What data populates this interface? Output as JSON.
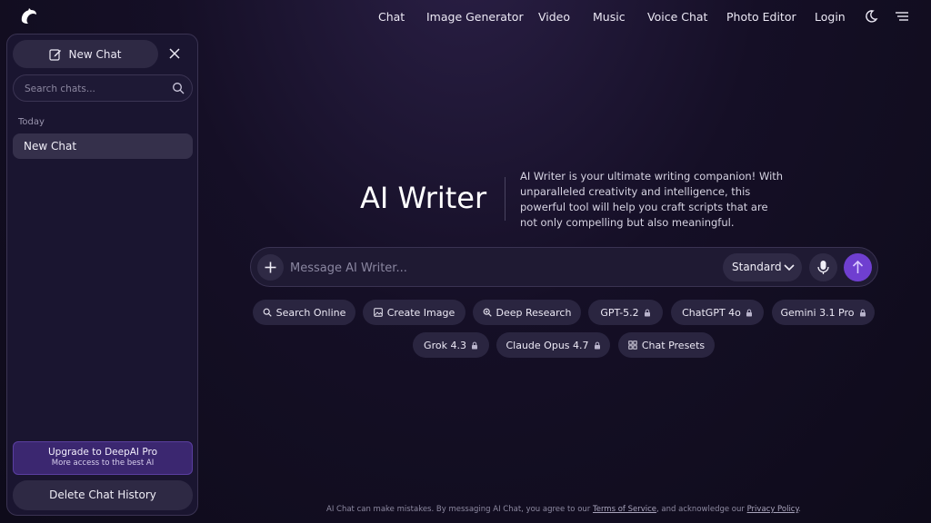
{
  "nav": {
    "links": [
      "Chat",
      "Image Generator",
      "Video",
      "Music",
      "Voice Chat",
      "Photo Editor",
      "Login"
    ],
    "logo_icon": "dolphin-logo-icon",
    "theme_icon": "moon-icon",
    "menu_icon": "hamburger-menu-icon"
  },
  "sidebar": {
    "new_chat_label": "New Chat",
    "search_placeholder": "Search chats...",
    "section_today": "Today",
    "chats": [
      "New Chat"
    ],
    "upgrade_title": "Upgrade to DeepAI Pro",
    "upgrade_subtitle": "More access to the best AI",
    "delete_label": "Delete Chat History"
  },
  "hero": {
    "title": "AI Writer",
    "description": "AI Writer is your ultimate writing companion! With unparalleled creativity and intelligence, this powerful tool will help you craft scripts that are not only compelling but also meaningful."
  },
  "composer": {
    "placeholder": "Message AI Writer...",
    "mode_value": "Standard"
  },
  "chips": [
    "Search Online",
    "Create Image",
    "Deep Research",
    "GPT-5.2",
    "ChatGPT 4o",
    "Gemini 3.1 Pro",
    "Grok 4.3",
    "Claude Opus 4.7",
    "Chat Presets"
  ],
  "footer": {
    "text_before": "AI Chat can make mistakes. By messaging AI Chat, you agree to our ",
    "terms": "Terms of Service",
    "text_mid": ", and acknowledge our ",
    "privacy": "Privacy Policy",
    "text_end": "."
  },
  "colors": {
    "accent": "#6f3fd0",
    "background": "#0f0c1c",
    "panel": "#1a1530"
  }
}
